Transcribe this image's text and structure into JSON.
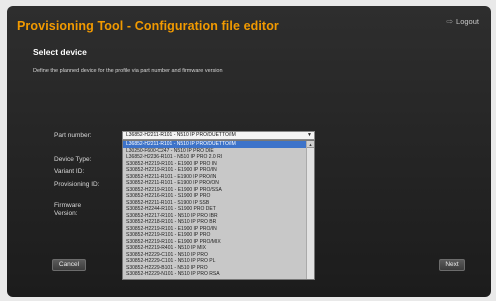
{
  "header": {
    "title": "Provisioning Tool - Configuration file editor",
    "logout_label": "Logout"
  },
  "page": {
    "subtitle": "Select device",
    "description": "Define the planned device for the profile via part number and firmware version"
  },
  "form": {
    "part_number_label": "Part number:",
    "device_type_label": "Device Type:",
    "variant_id_label": "Variant ID:",
    "provisioning_id_label": "Provisioning ID:",
    "firmware_label": "Firmware",
    "version_label": "Version:",
    "part_number_value": "L36852-H2211-R101 - N510 IP PRO/DUETTO/IM"
  },
  "dropdown": {
    "selected_index": 0,
    "options": [
      "L36852-H2211-R101 - N510 IP PRO/DUETTO/IM",
      "L30250-F600-C247 - N510 IP PRO DIE",
      "L36852-H2236-R101 - N510 IP PRO 2.0 RI",
      "S30852-H2219-R101 - E1900 IP PRO IN",
      "S30852-H2219-R101 - E1900 IP PRO/IN",
      "S30852-H2211-R101 - E1900 IP PRO/IN",
      "S30852-H2211-R101 - E1900 IP PRO/ON",
      "S30852-H2219-R101 - E1900 IP PRO/SSA",
      "S30852-H2216-R101 - S1900 IP PRO",
      "S30852-H2211-R101 - S1900 IP SSB",
      "S30852-H2244-R101 - S1900 PRO DET",
      "S30852-H2217-R101 - N510 IP PRO IBR",
      "S30852-H2218-R101 - N510 IP PRO BR",
      "S30852-H2219-R101 - E1900 IP PRO/IN",
      "S30852-H2219-R101 - E1900 IP PRO",
      "S30852-H2219-R101 - E1900 IP PRO/MIX",
      "S30852-H2219-R401 - N510 IP MIX",
      "S30852-H2229-C101 - N510 IP PRO",
      "S30852-H2229-C101 - N510 IP PRO PL",
      "S30852-H2229-B101 - N510 IP PRO",
      "S30852-H2229-N101 - N510 IP PRO RSA"
    ]
  },
  "footer": {
    "cancel_label": "Cancel",
    "next_label": "Next"
  }
}
